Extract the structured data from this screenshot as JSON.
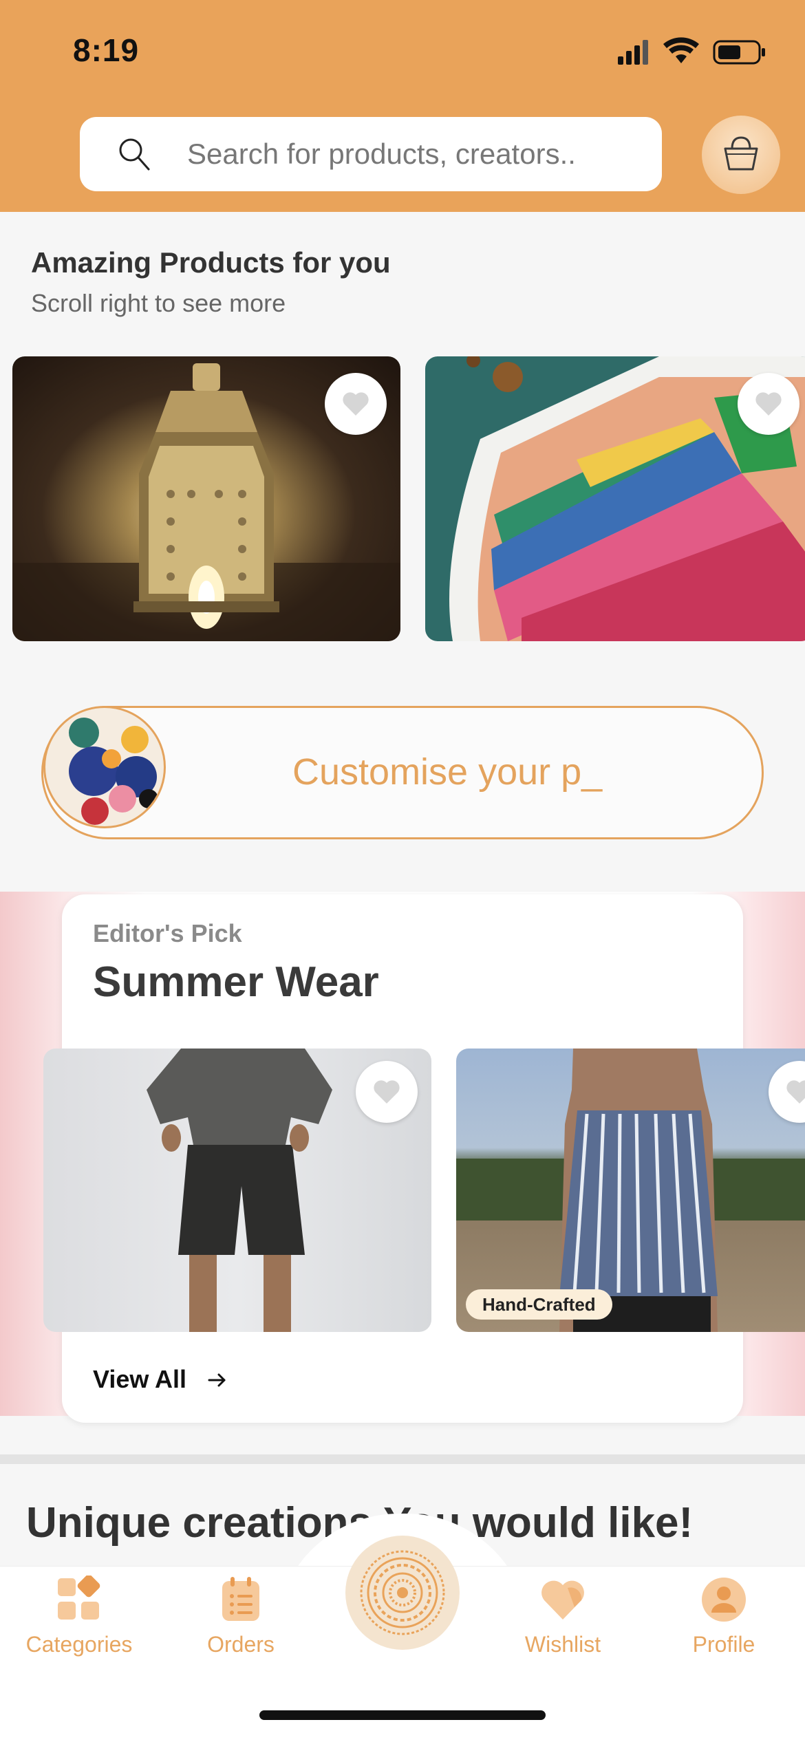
{
  "status_bar": {
    "time": "8:19"
  },
  "search": {
    "placeholder": "Search for products, creators.."
  },
  "featured": {
    "title": "Amazing Products for you",
    "subtitle": "Scroll right to see more"
  },
  "customise": {
    "text": "Customise your p_"
  },
  "editors_pick": {
    "kicker": "Editor's Pick",
    "title": "Summer Wear",
    "badge": "Hand-Crafted",
    "view_all": "View All"
  },
  "unique": {
    "title": "Unique creations You would like!"
  },
  "tabbar": {
    "items": [
      {
        "label": "Categories",
        "icon": "categories-icon"
      },
      {
        "label": "Orders",
        "icon": "orders-icon"
      },
      {
        "label": "",
        "icon": "mandala-home-icon"
      },
      {
        "label": "Wishlist",
        "icon": "heart-icon"
      },
      {
        "label": "Profile",
        "icon": "profile-icon"
      }
    ]
  },
  "colors": {
    "brand": "#e9a35a",
    "accent_text": "#e4a35d",
    "tab_label": "#e7a661"
  }
}
